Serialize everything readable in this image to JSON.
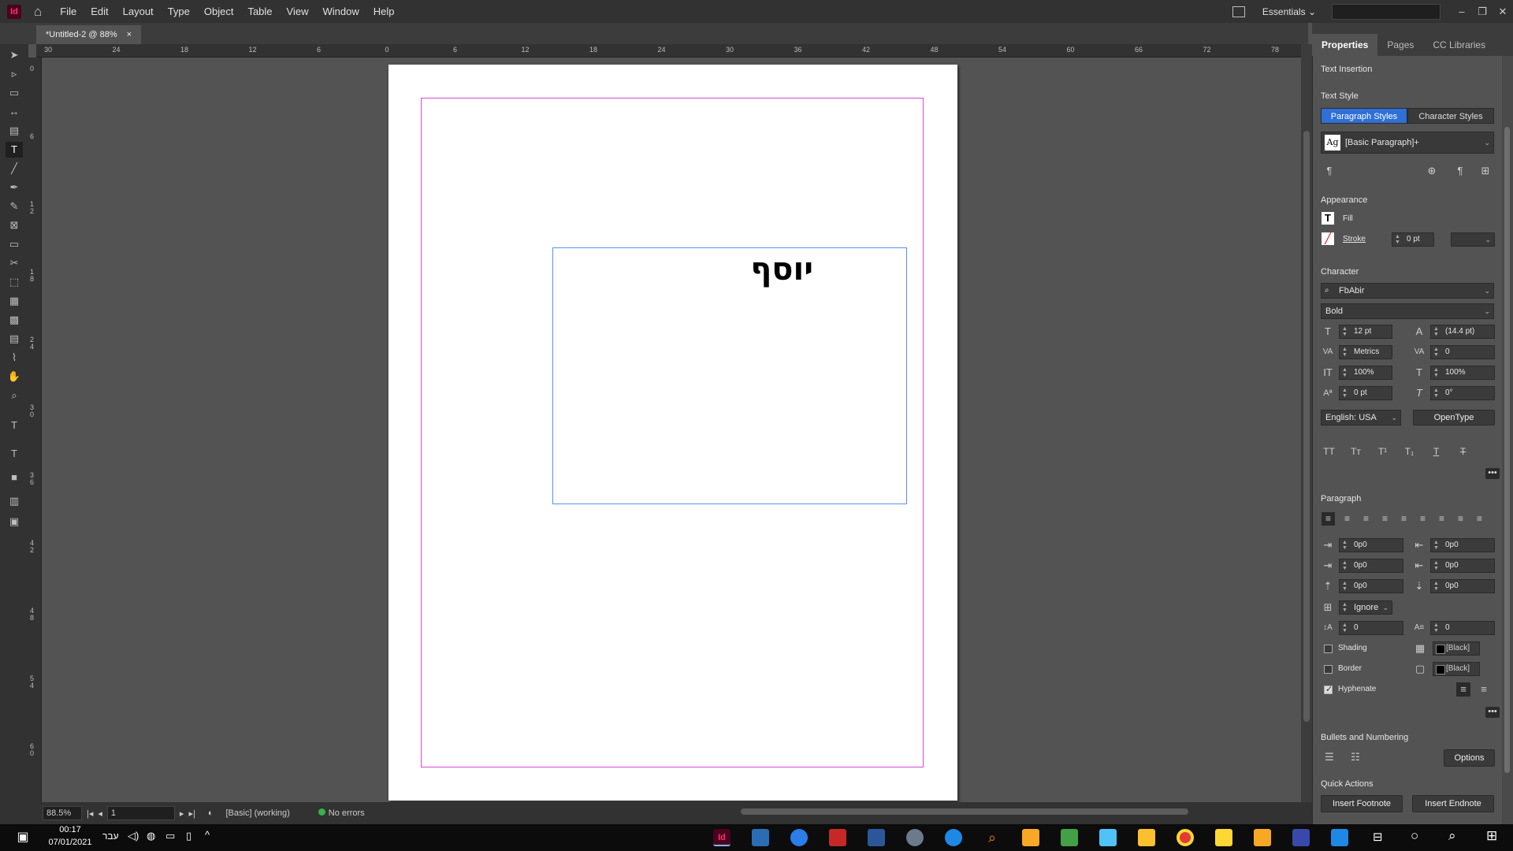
{
  "app": {
    "logo": "Id",
    "menus": [
      "File",
      "Edit",
      "Layout",
      "Type",
      "Object",
      "Table",
      "View",
      "Window",
      "Help"
    ],
    "workspace": "Essentials",
    "doc_tab": "*Untitled-2 @ 88%",
    "close_glyph": "×"
  },
  "ruler": {
    "h_labels": [
      "30",
      "24",
      "18",
      "12",
      "6",
      "0",
      "6",
      "12",
      "18",
      "24",
      "30",
      "36",
      "42",
      "48",
      "54",
      "60",
      "66",
      "72",
      "78"
    ],
    "v_labels": [
      "0",
      "6",
      "1 2",
      "1 8",
      "2 4",
      "3 0",
      "3 6",
      "4 2",
      "4 8",
      "5 4",
      "6 0"
    ]
  },
  "document": {
    "frame_text": "יוסף"
  },
  "status": {
    "zoom": "88.5%",
    "page": "1",
    "style": "[Basic] (working)",
    "preflight": "No errors"
  },
  "panel": {
    "tabs": [
      "Properties",
      "Pages",
      "CC Libraries"
    ],
    "section_text_insertion": "Text Insertion",
    "section_text_style": "Text Style",
    "style_tabs": [
      "Paragraph Styles",
      "Character Styles"
    ],
    "paragraph_style": "[Basic Paragraph]+",
    "style_icon_label": "Ag",
    "section_appearance": "Appearance",
    "fill_label": "Fill",
    "stroke_label": "Stroke",
    "stroke_weight": "0 pt",
    "section_character": "Character",
    "font_family": "FbAbir",
    "font_style": "Bold",
    "font_size": "12 pt",
    "leading": "(14.4 pt)",
    "kerning": "Metrics",
    "tracking": "0",
    "vertical_scale": "100%",
    "horizontal_scale": "100%",
    "baseline_shift": "0 pt",
    "skew": "0°",
    "language": "English: USA",
    "opentype": "OpenType",
    "char_format_buttons": [
      "TT",
      "Tт",
      "T¹",
      "T₁",
      "T",
      "T"
    ],
    "section_paragraph": "Paragraph",
    "left_indent": "0p0",
    "right_indent": "0p0",
    "first_line_indent": "0p0",
    "last_line_indent": "0p0",
    "space_before": "0p0",
    "space_after": "0p0",
    "align_to_grid": "Ignore",
    "drop_cap_lines": "0",
    "drop_cap_chars": "0",
    "shading_label": "Shading",
    "shading_color": "[Black]",
    "border_label": "Border",
    "border_color": "[Black]",
    "hyphenate_label": "Hyphenate",
    "section_bullets": "Bullets and Numbering",
    "options_button": "Options",
    "section_quick_actions": "Quick Actions",
    "insert_footnote": "Insert Footnote",
    "insert_endnote": "Insert Endnote"
  },
  "taskbar": {
    "time": "00:17",
    "date": "07/01/2021",
    "lang": "עבר"
  },
  "colors": {
    "accent": "#2e6fd8",
    "margin_guide": "#d946d9",
    "frame_edge": "#5b8ff0"
  }
}
